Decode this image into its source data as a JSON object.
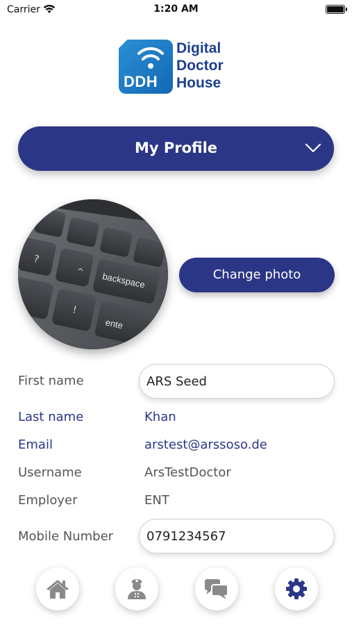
{
  "status_bar": {
    "carrier": "Carrier",
    "time": "1:20 AM"
  },
  "logo": {
    "mark_text": "DDH",
    "line1": "Digital",
    "line2": "Doctor",
    "line3": "House"
  },
  "profile_dropdown": {
    "title": "My Profile",
    "icon": "chevron-down-icon"
  },
  "photo": {
    "change_label": "Change photo",
    "backspace_key": "backspace",
    "enter_key": "ente"
  },
  "form": {
    "first_name_label": "First name",
    "first_name_value": "ARS Seed",
    "last_name_label": "Last name",
    "last_name_value": "Khan",
    "email_label": "Email",
    "email_value": "arstest@arssoso.de",
    "username_label": "Username",
    "username_value": "ArsTestDoctor",
    "employer_label": "Employer",
    "employer_value": "ENT",
    "mobile_label": "Mobile Number",
    "mobile_value": "0791234567"
  },
  "colors": {
    "primary": "#2b3686",
    "logo_blue": "#1c3f91",
    "logo_mark": "#1368b4",
    "nav_icon_gray": "#8a8a8a"
  },
  "bottom_nav": [
    {
      "icon": "home-icon",
      "active": false
    },
    {
      "icon": "doctor-icon",
      "active": false
    },
    {
      "icon": "chat-icon",
      "active": false
    },
    {
      "icon": "gear-icon",
      "active": true
    }
  ]
}
